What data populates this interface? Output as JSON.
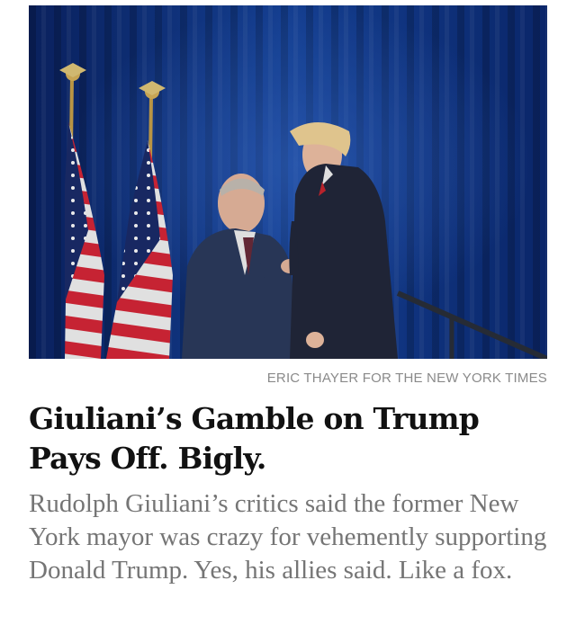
{
  "article": {
    "photo_credit": "ERIC THAYER FOR THE NEW YORK TIMES",
    "headline": "Giuliani’s Gamble on Trump Pays Off. Bigly.",
    "summary": "Rudolph Giuliani’s critics said the former New York mayor was crazy for vehemently supporting Donald Trump. Yes, his allies said. Like a fox."
  },
  "icons": {
    "photo": "news-photo-image"
  }
}
